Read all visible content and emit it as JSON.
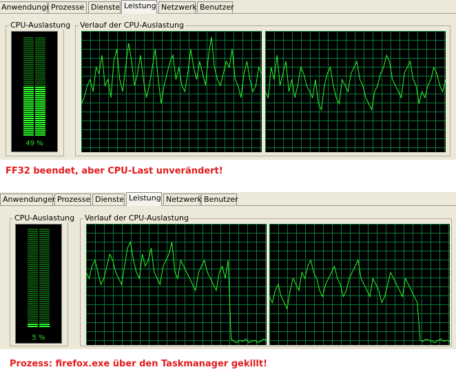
{
  "panels": [
    {
      "tabs": [
        "Anwendungen",
        "Prozesse",
        "Dienste",
        "Leistung",
        "Netzwerk",
        "Benutzer"
      ],
      "active_tab": 3,
      "cpu_group_label": "CPU-Auslastung",
      "history_group_label": "Verlauf der CPU-Auslastung",
      "cpu_percent_text": "49 %",
      "cpu_usage_percent": 49,
      "history_core1": [
        40,
        45,
        55,
        60,
        50,
        70,
        65,
        80,
        55,
        60,
        45,
        75,
        85,
        60,
        50,
        70,
        90,
        75,
        55,
        65,
        80,
        60,
        45,
        55,
        70,
        85,
        60,
        40,
        55,
        65,
        75,
        80,
        60,
        70,
        55,
        50,
        65,
        85,
        70,
        60,
        75,
        65,
        55,
        80,
        95,
        70,
        60,
        55,
        65,
        75,
        70,
        85,
        60,
        55,
        45,
        65,
        75,
        60,
        50,
        55,
        70,
        65
      ],
      "history_core2": [
        50,
        45,
        70,
        60,
        80,
        55,
        65,
        75,
        50,
        60,
        45,
        55,
        70,
        65,
        55,
        50,
        45,
        60,
        40,
        35,
        55,
        65,
        70,
        55,
        45,
        40,
        60,
        55,
        50,
        65,
        70,
        75,
        60,
        55,
        45,
        40,
        35,
        50,
        55,
        65,
        70,
        80,
        75,
        60,
        55,
        50,
        45,
        65,
        70,
        75,
        60,
        55,
        40,
        50,
        45,
        55,
        60,
        70,
        65,
        55,
        50,
        60
      ]
    },
    {
      "tabs": [
        "Anwendungen",
        "Prozesse",
        "Dienste",
        "Leistung",
        "Netzwerk",
        "Benutzer"
      ],
      "active_tab": 3,
      "cpu_group_label": "CPU-Auslastung",
      "history_group_label": "Verlauf der CPU-Auslastung",
      "cpu_percent_text": "5 %",
      "cpu_usage_percent": 5,
      "history_core1": [
        60,
        55,
        65,
        70,
        60,
        50,
        55,
        65,
        75,
        70,
        60,
        55,
        50,
        65,
        80,
        85,
        70,
        60,
        55,
        75,
        65,
        70,
        80,
        60,
        55,
        50,
        65,
        70,
        75,
        85,
        60,
        55,
        70,
        65,
        60,
        55,
        50,
        45,
        60,
        65,
        70,
        60,
        55,
        50,
        45,
        60,
        65,
        55,
        70,
        5,
        3,
        2,
        4,
        3,
        5,
        2,
        3,
        4,
        2,
        3,
        5,
        4
      ],
      "history_core2": [
        40,
        35,
        45,
        50,
        40,
        35,
        30,
        45,
        55,
        50,
        45,
        60,
        55,
        65,
        70,
        60,
        55,
        45,
        40,
        50,
        55,
        60,
        65,
        55,
        50,
        40,
        45,
        55,
        60,
        65,
        70,
        55,
        50,
        45,
        40,
        55,
        50,
        45,
        35,
        40,
        50,
        60,
        55,
        50,
        45,
        40,
        55,
        50,
        45,
        40,
        35,
        4,
        3,
        5,
        4,
        3,
        2,
        4,
        5,
        3,
        4,
        3
      ]
    }
  ],
  "captions": {
    "top": "FF32 beendet, aber CPU-Last unverändert!",
    "bottom": "Prozess: firefox.exe über den Taskmanager gekillt!"
  }
}
